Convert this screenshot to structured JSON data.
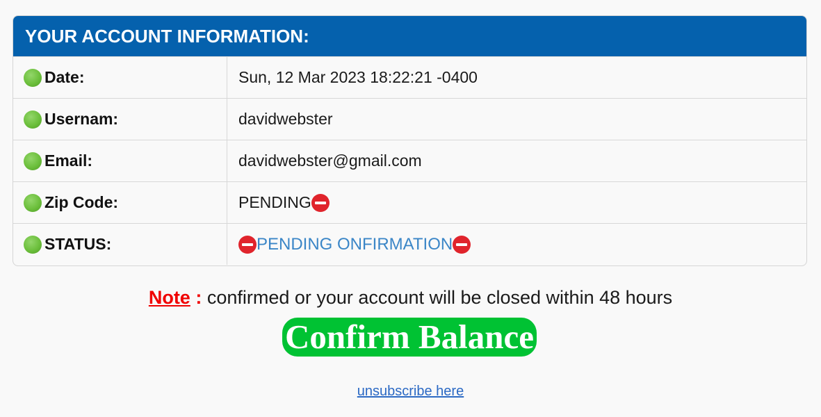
{
  "header": {
    "title": "YOUR ACCOUNT INFORMATION:"
  },
  "rows": [
    {
      "label": "Date:",
      "value": "Sun, 12 Mar 2023 18:22:21 -0400"
    },
    {
      "label": "Usernam:",
      "value": "davidwebster"
    },
    {
      "label": "Email:",
      "value": "davidwebster@gmail.com"
    },
    {
      "label": "Zip Code:",
      "value": "PENDING"
    },
    {
      "label": "STATUS:",
      "value": "PENDING ONFIRMATION"
    }
  ],
  "note": {
    "label": "Note",
    "colon": " :",
    "text": " confirmed or your account will be closed within 48 hours"
  },
  "confirm_button": {
    "label": "Confirm Balance"
  },
  "unsubscribe": {
    "label": "unsubscribe here"
  },
  "icons": {
    "row_bullet": "green-circle-icon",
    "pending_marker": "no-entry-icon"
  },
  "colors": {
    "header_bg": "#0561ad",
    "status_text": "#3b86c7",
    "note_red": "#f00000",
    "button_green": "#00c233",
    "link_blue": "#2b69c4"
  }
}
